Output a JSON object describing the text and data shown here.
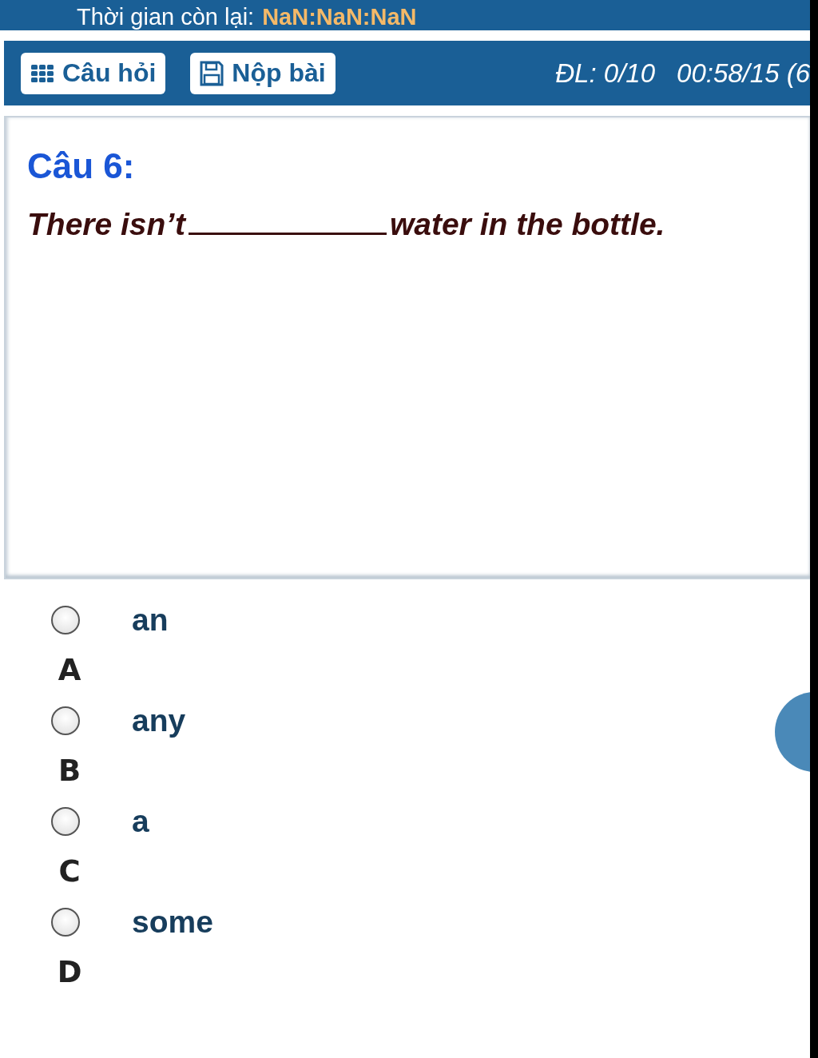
{
  "timer_bar": {
    "label": "Thời gian còn lại:",
    "value": "NaN:NaN:NaN"
  },
  "toolbar": {
    "buttons": [
      {
        "kind": "questions",
        "label": "Câu hỏi"
      },
      {
        "kind": "submit",
        "label": "Nộp bài"
      }
    ],
    "answered": "ĐL: 0/10",
    "elapsed": "00:58/15 (6"
  },
  "question": {
    "title": "Câu 6:",
    "text_before": "There isn’t",
    "text_after": "water in the bottle."
  },
  "options": [
    {
      "text": "an",
      "letter": "A",
      "selected": false
    },
    {
      "text": "any",
      "letter": "B",
      "selected": false
    },
    {
      "text": "a",
      "letter": "C",
      "selected": false
    },
    {
      "text": "some",
      "letter": "D",
      "selected": false
    }
  ]
}
